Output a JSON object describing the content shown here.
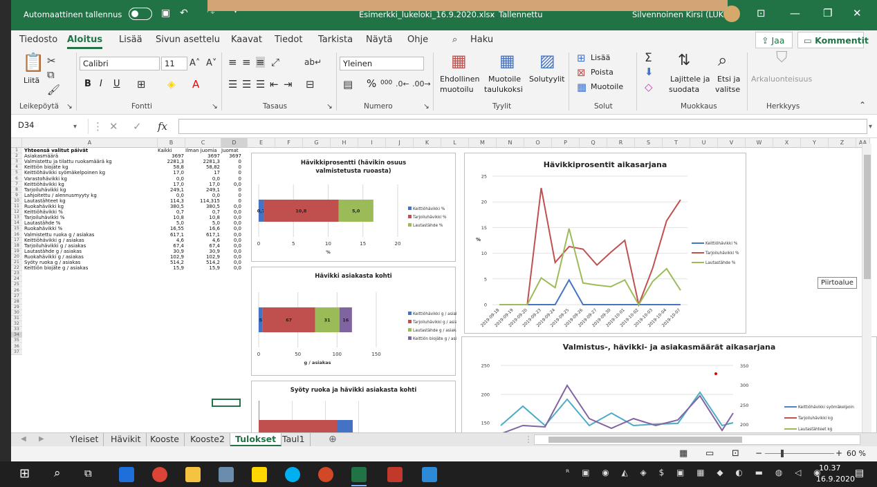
{
  "titlebar": {
    "autosave": "Automaattinen tallennus",
    "filename": "Esimerkki_lukeloki_16.9.2020.xlsx",
    "sep": "-",
    "saved": "Tallennettu",
    "user": "Silvennoinen Kirsi (LUKE)"
  },
  "menu": {
    "items": [
      "Tiedosto",
      "Aloitus",
      "Lisää",
      "Sivun asettelu",
      "Kaavat",
      "Tiedot",
      "Tarkista",
      "Näytä",
      "Ohje"
    ],
    "search": "Haku",
    "share": "Jaa",
    "comments": "Kommentit"
  },
  "ribbon": {
    "paste": "Liitä",
    "clipboard": "Leikepöytä",
    "font_name": "Calibri",
    "font_size": "11",
    "font_group": "Fontti",
    "bold": "B",
    "italic": "I",
    "underline": "U",
    "align_group": "Tasaus",
    "number_format": "Yleinen",
    "number_group": "Numero",
    "percent": "%",
    "thousands": "000",
    "cond_format": [
      "Ehdollinen",
      "muotoilu"
    ],
    "format_table": [
      "Muotoile",
      "taulukoksi"
    ],
    "cell_styles": [
      "Solutyylit"
    ],
    "styles_group": "Tyylit",
    "insert": "Lisää",
    "delete": "Poista",
    "format": "Muotoile",
    "cells_group": "Solut",
    "sort_filter": [
      "Lajittele ja",
      "suodata"
    ],
    "find": [
      "Etsi ja",
      "valitse"
    ],
    "editing_group": "Muokkaus",
    "sensitivity": "Arkaluonteisuus",
    "sensitivity_group": "Herkkyys"
  },
  "formula": {
    "namebox": "D34",
    "fx": "fx",
    "content": ""
  },
  "columns": [
    "A",
    "B",
    "C",
    "D",
    "E",
    "F",
    "G",
    "H",
    "I",
    "J",
    "K",
    "L",
    "M",
    "N",
    "O",
    "P",
    "Q",
    "R",
    "S",
    "T",
    "U",
    "V",
    "W",
    "X",
    "Y",
    "Z",
    "AA"
  ],
  "rows": [
    [
      "Yhteensä valitut päivät",
      "Kaikki",
      "Ilman juomia",
      "Juomat"
    ],
    [
      "Asiakasmäärä",
      "3697",
      "3697",
      "3697"
    ],
    [
      "Valmistettu ja tilattu ruokamäärä kg",
      "2281,3",
      "2281,3",
      "0"
    ],
    [
      "Keittiön biojäte kg",
      "58,8",
      "58,82",
      "0"
    ],
    [
      "Keittiöhävikki syömäkelpoinen kg",
      "17,0",
      "17",
      "0"
    ],
    [
      "Varastohävikki kg",
      "0,0",
      "0,0",
      "0"
    ],
    [
      "Keittiöhävikki kg",
      "17,0",
      "17,0",
      "0,0"
    ],
    [
      "Tarjoiluhävikki kg",
      "249,1",
      "249,1",
      "0"
    ],
    [
      "Lahjoitettu / alennusmyyty kg",
      "0,0",
      "0,0",
      "0"
    ],
    [
      "Lautastähteet kg",
      "114,3",
      "114,315",
      "0"
    ],
    [
      "Ruokahävikki kg",
      "380,5",
      "380,5",
      "0,0"
    ],
    [
      "Keittiöhävikki %",
      "0,7",
      "0,7",
      "0,0"
    ],
    [
      "Tarjoiluhävikki %",
      "10,8",
      "10,8",
      "0,0"
    ],
    [
      "Lautastähde %",
      "5,0",
      "5,0",
      "0,0"
    ],
    [
      "Ruokahävikki %",
      "16,55",
      "16,6",
      "0,0"
    ],
    [
      "Valmistettu ruoka g / asiakas",
      "617,1",
      "617,1",
      "0,0"
    ],
    [
      "Keittiöhävikki g / asiakas",
      "4,6",
      "4,6",
      "0,0"
    ],
    [
      "Tarjoiluhävikki g / asiakas",
      "67,4",
      "67,4",
      "0,0"
    ],
    [
      "Lautastähde g / asiakas",
      "30,9",
      "30,9",
      "0,0"
    ],
    [
      "Ruokahävikki g / asiakas",
      "102,9",
      "102,9",
      "0,0"
    ],
    [
      "Syöty ruoka g / asiakas",
      "514,2",
      "514,2",
      "0,0"
    ],
    [
      "Keittiön biojäte g / asiakas",
      "15,9",
      "15,9",
      "0,0"
    ]
  ],
  "tooltip": "Piirtoalue",
  "tabs": [
    "Yleiset",
    "Hävikit",
    "Kooste",
    "Kooste2",
    "Tulokset",
    "Taul1"
  ],
  "status": {
    "zoom": "60 %"
  },
  "taskbar": {
    "time": "10.37",
    "date": "16.9.2020"
  },
  "chart_data": [
    {
      "type": "bar",
      "title": "Hävikkiprosentti (hävikin osuus valmistetusta ruoasta)",
      "xlabel": "%",
      "xlim": [
        0,
        20
      ],
      "xticks": [
        "0",
        "5",
        "10",
        "15",
        "20"
      ],
      "series": [
        {
          "name": "Keittiöhävikki %",
          "values": [
            0.7
          ],
          "color": "#4472c4",
          "label": "0,7"
        },
        {
          "name": "Tarjoiluhävikki %",
          "values": [
            10.8
          ],
          "color": "#c0504d",
          "label": "10,8"
        },
        {
          "name": "Lautastähde %",
          "values": [
            5.0
          ],
          "color": "#9bbb59",
          "label": "5,0"
        }
      ]
    },
    {
      "type": "bar",
      "title": "Hävikki asiakasta kohti",
      "xlabel": "g / asiakas",
      "xlim": [
        0,
        150
      ],
      "xticks": [
        "0",
        "50",
        "100",
        "150"
      ],
      "series": [
        {
          "name": "Keittiöhävikki g / asiakas",
          "values": [
            5
          ],
          "color": "#4472c4",
          "label": "5"
        },
        {
          "name": "Tarjoiluhävikki g / asiakas",
          "values": [
            67
          ],
          "color": "#c0504d",
          "label": "67"
        },
        {
          "name": "Lautastähde g / asiakas",
          "values": [
            31
          ],
          "color": "#9bbb59",
          "label": "31"
        },
        {
          "name": "Keittiön biojäte g / asiakas",
          "values": [
            16
          ],
          "color": "#8064a2",
          "label": "16"
        }
      ]
    },
    {
      "type": "bar",
      "title": "Syöty ruoka ja hävikki asiakasta kohti"
    },
    {
      "type": "line",
      "title": "Hävikkiprosentit aikasarjana",
      "ylabel": "%",
      "ylim": [
        0,
        25
      ],
      "yticks": [
        "0",
        "5",
        "10",
        "15",
        "20",
        "25"
      ],
      "x": [
        "2019-09-18",
        "2019-09-19",
        "2019-09-20",
        "2019-09-23",
        "2019-09-24",
        "2019-09-25",
        "2019-09-26",
        "2019-09-27",
        "2019-09-30",
        "2019-10-01",
        "2019-10-02",
        "2019-10-03",
        "2019-10-04",
        "2019-10-07"
      ],
      "series": [
        {
          "name": "Keittiöhävikki %",
          "color": "#4472c4",
          "values": [
            0,
            0,
            0,
            0,
            0,
            4.8,
            0,
            0,
            0,
            0,
            0,
            0,
            0,
            0
          ]
        },
        {
          "name": "Tarjoiluhävikki %",
          "color": "#c0504d",
          "values": [
            0,
            0,
            0,
            22.7,
            8.2,
            11.3,
            10.8,
            7.7,
            10.2,
            12.5,
            0,
            7.1,
            16.3,
            20.4
          ]
        },
        {
          "name": "Lautastähde %",
          "color": "#9bbb59",
          "values": [
            0,
            0,
            0,
            5.2,
            3.3,
            14.8,
            4.2,
            3.8,
            3.5,
            4.8,
            0,
            4.5,
            7.0,
            2.8
          ]
        }
      ]
    },
    {
      "type": "line",
      "title": "Valmistus-, hävikki- ja asiakasmäärät aikasarjana",
      "yticks_left": [
        "150",
        "200",
        "250"
      ],
      "yticks_right": [
        "200",
        "250",
        "300",
        "350"
      ],
      "series": [
        {
          "name": "Keittiöhävikki syömäkelpoin",
          "color": "#4f81bd"
        },
        {
          "name": "Tarjoiluhävikki kg",
          "color": "#c0504d"
        },
        {
          "name": "Lautastähteet kg",
          "color": "#9bbb59"
        }
      ]
    }
  ]
}
